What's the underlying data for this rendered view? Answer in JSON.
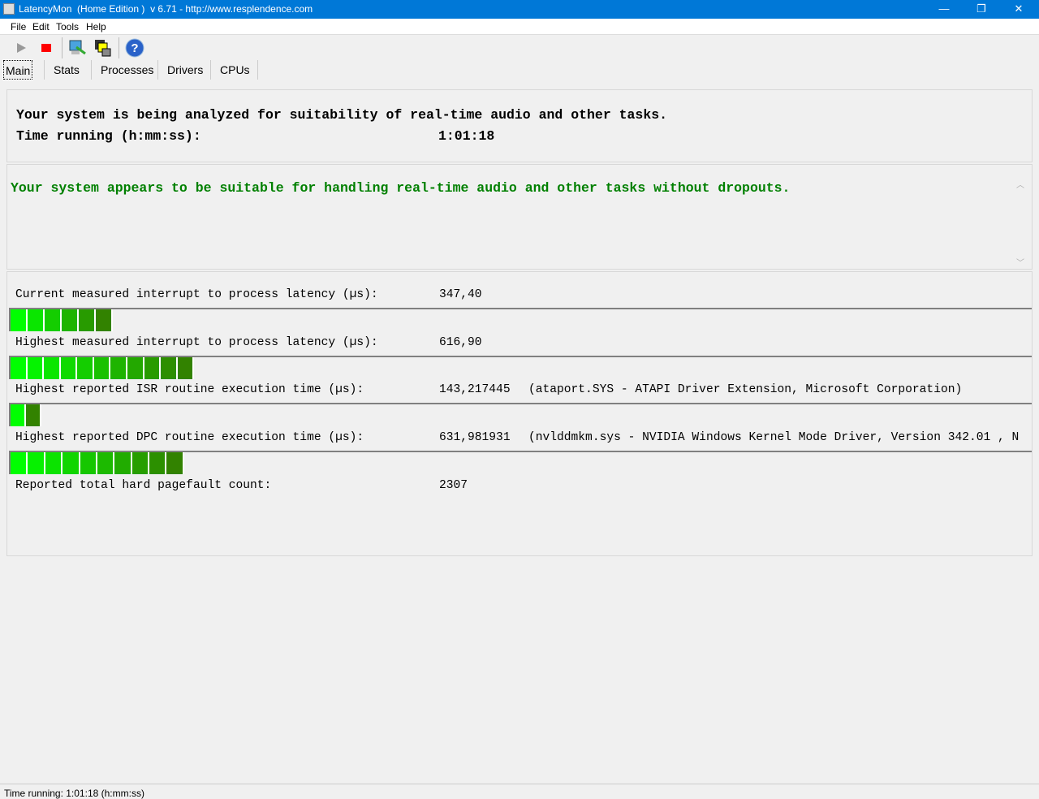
{
  "window": {
    "title": "LatencyMon  (Home Edition )  v 6.71 - http://www.resplendence.com",
    "minimize": "—",
    "restore": "❐",
    "close": "✕"
  },
  "menu": [
    "File",
    "Edit",
    "Tools",
    "Help"
  ],
  "toolbar": [
    {
      "icon": "play-icon"
    },
    {
      "icon": "stop-icon"
    },
    {
      "icon": "computer-wrench-icon"
    },
    {
      "icon": "windows-icon"
    },
    {
      "icon": "help-icon"
    }
  ],
  "tabs": [
    "Main",
    "Stats",
    "Processes",
    "Drivers",
    "CPUs"
  ],
  "header": {
    "line1": "Your system is being analyzed for suitability of real-time audio and other tasks.",
    "line2": "Time running (h:mm:ss):",
    "time": "1:01:18"
  },
  "verdict": {
    "text": "Your system appears to be suitable for handling real-time audio and other tasks without dropouts.",
    "color": "#008000"
  },
  "metrics": [
    {
      "label": "Current measured interrupt to process latency (µs):",
      "value": "347,40",
      "detail": "",
      "bar_percent": 10,
      "segments": 6
    },
    {
      "label": "Highest measured interrupt to process latency (µs):",
      "value": "616,90",
      "detail": "",
      "bar_percent": 18,
      "segments": 11
    },
    {
      "label": "Highest reported ISR routine execution time (µs):",
      "value": "143,217445",
      "detail": "(ataport.SYS - ATAPI Driver Extension, Microsoft Corporation)",
      "bar_percent": 3,
      "segments": 2
    },
    {
      "label": "Highest reported DPC routine execution time (µs):",
      "value": "631,981931",
      "detail": "(nvlddmkm.sys - NVIDIA Windows Kernel Mode Driver, Version 342.01 , N",
      "bar_percent": 17,
      "segments": 10
    }
  ],
  "pagefault": {
    "label": "Reported total hard pagefault count:",
    "value": "2307"
  },
  "status": "Time running: 1:01:18  (h:mm:ss)"
}
